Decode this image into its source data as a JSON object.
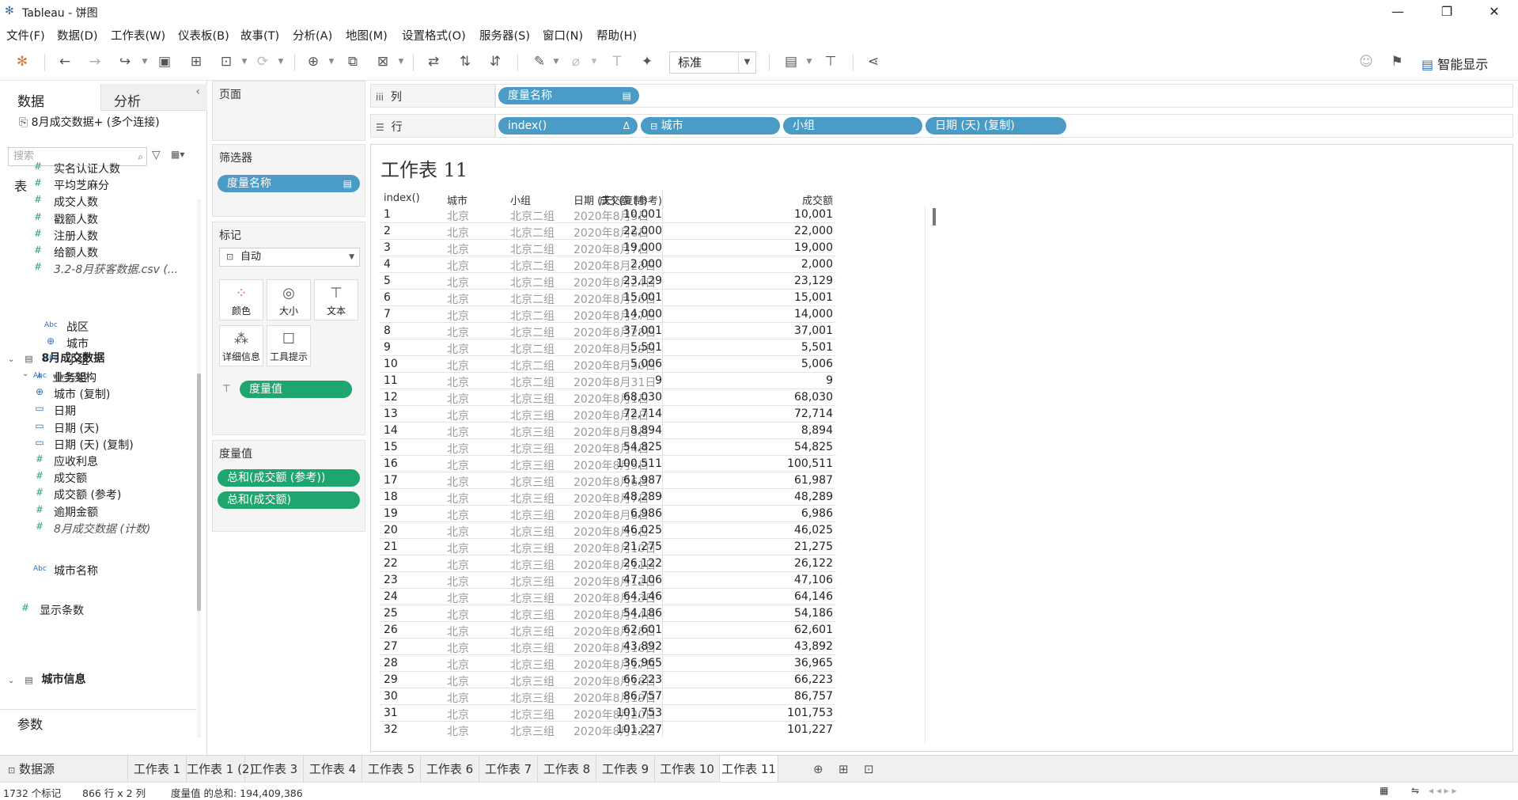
{
  "window": {
    "title": "Tableau - 饼图",
    "minimize": "—",
    "restore": "❐",
    "close": "✕"
  },
  "menu": [
    "文件(F)",
    "数据(D)",
    "工作表(W)",
    "仪表板(B)",
    "故事(T)",
    "分析(A)",
    "地图(M)",
    "设置格式(O)",
    "服务器(S)",
    "窗口(N)",
    "帮助(H)"
  ],
  "toolbar": {
    "fit_value": "标准",
    "show_me_label": "智能显示"
  },
  "datapane": {
    "tab_data": "数据",
    "tab_analysis": "分析",
    "datasource": "8月成交数据+ (多个连接)",
    "search_placeholder": "搜索",
    "tables_header": "表",
    "fields_top": [
      {
        "icon": "#",
        "label": "实名认证人数"
      },
      {
        "icon": "#",
        "label": "平均芝麻分"
      },
      {
        "icon": "#",
        "label": "成交人数"
      },
      {
        "icon": "#",
        "label": "戳额人数"
      },
      {
        "icon": "#",
        "label": "注册人数"
      },
      {
        "icon": "#",
        "label": "给额人数"
      },
      {
        "icon": "#",
        "label": "3.2-8月获客数据.csv (..."
      }
    ],
    "table2_name": "8月成交数据",
    "hierarchy_name": "业务架构",
    "hierarchy_children": [
      {
        "icon": "Abc",
        "label": "战区"
      },
      {
        "icon": "⊕",
        "label": "城市"
      },
      {
        "icon": "Abc",
        "label": "小组"
      }
    ],
    "fields_table2": [
      {
        "icon": "Abc",
        "label": "业务组"
      },
      {
        "icon": "⊕",
        "label": "城市 (复制)"
      },
      {
        "icon": "▭",
        "label": "日期"
      },
      {
        "icon": "▭",
        "label": "日期 (天)"
      },
      {
        "icon": "▭",
        "label": "日期 (天) (复制)"
      },
      {
        "icon": "#",
        "label": "应收利息"
      },
      {
        "icon": "#",
        "label": "成交额"
      },
      {
        "icon": "#",
        "label": "成交额 (参考)"
      },
      {
        "icon": "#",
        "label": "逾期金额"
      },
      {
        "icon": "#",
        "label": "8月成交数据 (计数)"
      }
    ],
    "table3_name": "城市信息",
    "fields_table3": [
      {
        "icon": "Abc",
        "label": "城市名称"
      }
    ],
    "params_header": "参数",
    "params": [
      {
        "icon": "#",
        "label": "显示条数"
      }
    ]
  },
  "cards": {
    "pages_title": "页面",
    "filters_title": "筛选器",
    "filter_pill": "度量名称",
    "marks_title": "标记",
    "marks_type": "自动",
    "mark_buttons": [
      "颜色",
      "大小",
      "文本",
      "详细信息",
      "工具提示"
    ],
    "marks_pill": "度量值",
    "measure_values_title": "度量值",
    "measure_pills": [
      "总和(成交额 (参考))",
      "总和(成交额)"
    ]
  },
  "shelves": {
    "columns_label": "列",
    "rows_label": "行",
    "columns_pills": [
      "度量名称"
    ],
    "rows_pills": [
      "index()",
      "城市",
      "小组",
      "日期 (天) (复制)"
    ]
  },
  "view": {
    "sheet_title": "工作表 11",
    "headers": [
      "index()",
      "城市",
      "小组",
      "日期 (天) (复制)",
      "成交额 (参考)",
      "成交额"
    ],
    "rows": [
      [
        "1",
        "北京",
        "北京二组",
        "2020年8月5日",
        "10,001",
        "10,001"
      ],
      [
        "2",
        "北京",
        "北京二组",
        "2020年8月6日",
        "22,000",
        "22,000"
      ],
      [
        "3",
        "北京",
        "北京二组",
        "2020年8月7日",
        "19,000",
        "19,000"
      ],
      [
        "4",
        "北京",
        "北京二组",
        "2020年8月23日",
        "2,000",
        "2,000"
      ],
      [
        "5",
        "北京",
        "北京二组",
        "2020年8月24日",
        "23,129",
        "23,129"
      ],
      [
        "6",
        "北京",
        "北京二组",
        "2020年8月26日",
        "15,001",
        "15,001"
      ],
      [
        "7",
        "北京",
        "北京二组",
        "2020年8月27日",
        "14,000",
        "14,000"
      ],
      [
        "8",
        "北京",
        "北京二组",
        "2020年8月28日",
        "37,001",
        "37,001"
      ],
      [
        "9",
        "北京",
        "北京二组",
        "2020年8月29日",
        "5,501",
        "5,501"
      ],
      [
        "10",
        "北京",
        "北京二组",
        "2020年8月30日",
        "5,006",
        "5,006"
      ],
      [
        "11",
        "北京",
        "北京二组",
        "2020年8月31日",
        "9",
        "9"
      ],
      [
        "12",
        "北京",
        "北京三组",
        "2020年8月1日",
        "68,030",
        "68,030"
      ],
      [
        "13",
        "北京",
        "北京三组",
        "2020年8月2日",
        "72,714",
        "72,714"
      ],
      [
        "14",
        "北京",
        "北京三组",
        "2020年8月3日",
        "8,894",
        "8,894"
      ],
      [
        "15",
        "北京",
        "北京三组",
        "2020年8月4日",
        "54,825",
        "54,825"
      ],
      [
        "16",
        "北京",
        "北京三组",
        "2020年8月5日",
        "100,511",
        "100,511"
      ],
      [
        "17",
        "北京",
        "北京三组",
        "2020年8月6日",
        "61,987",
        "61,987"
      ],
      [
        "18",
        "北京",
        "北京三组",
        "2020年8月7日",
        "48,289",
        "48,289"
      ],
      [
        "19",
        "北京",
        "北京三组",
        "2020年8月8日",
        "6,986",
        "6,986"
      ],
      [
        "20",
        "北京",
        "北京三组",
        "2020年8月9日",
        "46,025",
        "46,025"
      ],
      [
        "21",
        "北京",
        "北京三组",
        "2020年8月10日",
        "21,275",
        "21,275"
      ],
      [
        "22",
        "北京",
        "北京三组",
        "2020年8月11日",
        "26,122",
        "26,122"
      ],
      [
        "23",
        "北京",
        "北京三组",
        "2020年8月12日",
        "47,106",
        "47,106"
      ],
      [
        "24",
        "北京",
        "北京三组",
        "2020年8月13日",
        "64,146",
        "64,146"
      ],
      [
        "25",
        "北京",
        "北京三组",
        "2020年8月14日",
        "54,186",
        "54,186"
      ],
      [
        "26",
        "北京",
        "北京三组",
        "2020年8月15日",
        "62,601",
        "62,601"
      ],
      [
        "27",
        "北京",
        "北京三组",
        "2020年8月16日",
        "43,892",
        "43,892"
      ],
      [
        "28",
        "北京",
        "北京三组",
        "2020年8月17日",
        "36,965",
        "36,965"
      ],
      [
        "29",
        "北京",
        "北京三组",
        "2020年8月18日",
        "66,223",
        "66,223"
      ],
      [
        "30",
        "北京",
        "北京三组",
        "2020年8月19日",
        "86,757",
        "86,757"
      ],
      [
        "31",
        "北京",
        "北京三组",
        "2020年8月20日",
        "101,753",
        "101,753"
      ],
      [
        "32",
        "北京",
        "北京三组",
        "2020年8月21日",
        "101,227",
        "101,227"
      ]
    ]
  },
  "sheet_tabs": {
    "datasource_tab": "数据源",
    "tabs": [
      "工作表 1",
      "工作表 1 (2)",
      "工作表 3",
      "工作表 4",
      "工作表 5",
      "工作表 6",
      "工作表 7",
      "工作表 8",
      "工作表 9",
      "工作表 10",
      "工作表 11"
    ],
    "active_tab": "工作表 11"
  },
  "status": {
    "marks": "1732 个标记",
    "rows_cols": "866 行 x 2 列",
    "sum": "度量值 的总和: 194,409,386"
  },
  "colors": {
    "pill_blue": "#4a9bc6",
    "pill_green": "#1fa66f"
  }
}
